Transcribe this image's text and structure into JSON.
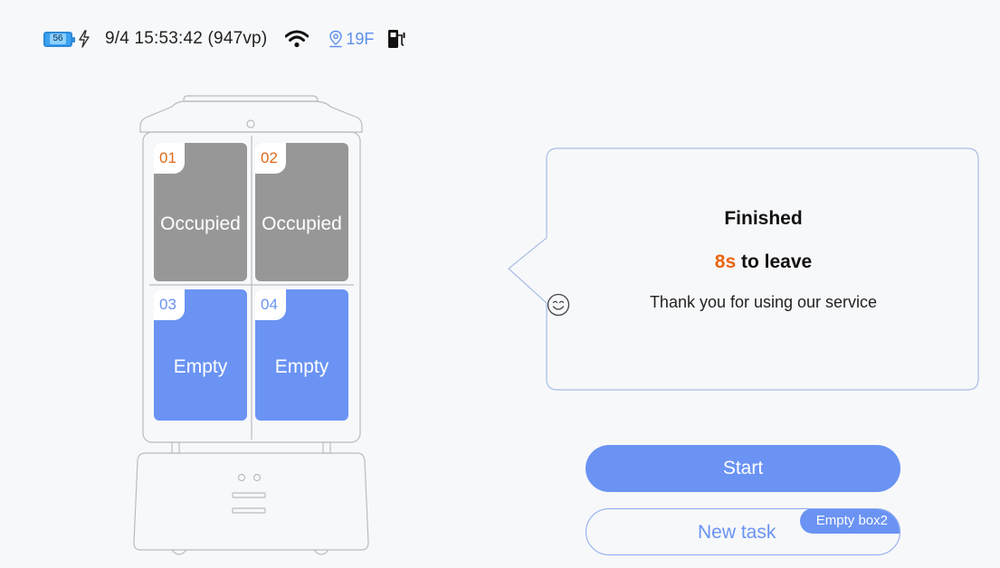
{
  "status_bar": {
    "battery_level": "56",
    "datetime": "9/4 15:53:42 (947vp)",
    "floor": "19F",
    "icons": [
      "battery-icon",
      "charging-bolt-icon",
      "wifi-icon",
      "location-pin-icon",
      "charging-station-icon"
    ]
  },
  "lockers": [
    {
      "number": "01",
      "status": "Occupied"
    },
    {
      "number": "02",
      "status": "Occupied"
    },
    {
      "number": "03",
      "status": "Empty"
    },
    {
      "number": "04",
      "status": "Empty"
    }
  ],
  "message": {
    "title": "Finished",
    "countdown_value": "8s",
    "countdown_text": " to leave",
    "thanks": "Thank you for using our service"
  },
  "actions": {
    "start_label": "Start",
    "new_task_label": "New task",
    "new_task_badge": "Empty box2"
  },
  "colors": {
    "accent_blue": "#6a93f3",
    "occupied_gray": "#979797",
    "countdown_orange": "#e8650f",
    "background": "#f7f8fa"
  }
}
